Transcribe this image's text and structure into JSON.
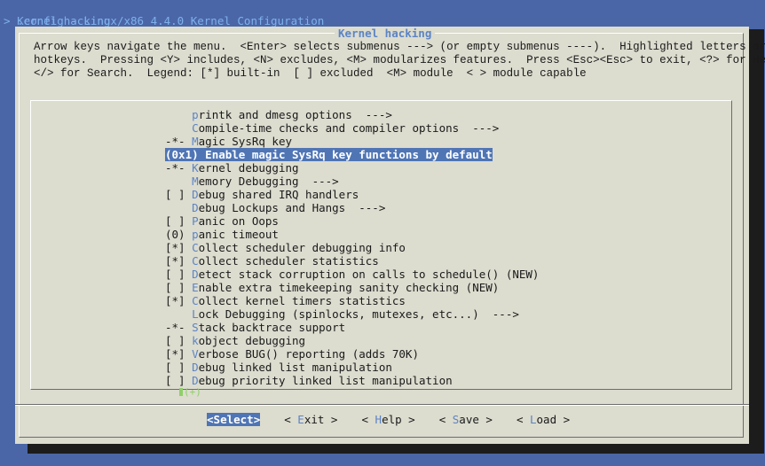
{
  "terminal": {
    "title": ".config - Linux/x86 4.4.0 Kernel Configuration",
    "breadcrumb_marker": ">",
    "breadcrumb": "Kernel hacking"
  },
  "dialog": {
    "title": "Kernel hacking",
    "instructions": [
      "Arrow keys navigate the menu.  <Enter> selects submenus ---> (or empty submenus ----).  Highlighted letters are",
      "hotkeys.  Pressing <Y> includes, <N> excludes, <M> modularizes features.  Press <Esc><Esc> to exit, <?> for Help,",
      "</> for Search.  Legend: [*] built-in  [ ] excluded  <M> module  < > module capable"
    ]
  },
  "menu": {
    "selected_index": 3,
    "items": [
      {
        "prefix": "    ",
        "hot": "p",
        "rest": "rintk and dmesg options  --->"
      },
      {
        "prefix": "    ",
        "hot": "C",
        "rest": "ompile-time checks and compiler options  --->"
      },
      {
        "prefix": "-*- ",
        "hot": "M",
        "rest": "agic SysRq key"
      },
      {
        "prefix": "(0x1) ",
        "hot": "E",
        "rest": "nable magic SysRq key functions by default"
      },
      {
        "prefix": "-*- ",
        "hot": "K",
        "rest": "ernel debugging"
      },
      {
        "prefix": "    ",
        "hot": "M",
        "rest": "emory Debugging  --->"
      },
      {
        "prefix": "[ ] ",
        "hot": "D",
        "rest": "ebug shared IRQ handlers"
      },
      {
        "prefix": "    ",
        "hot": "D",
        "rest": "ebug Lockups and Hangs  --->"
      },
      {
        "prefix": "[ ] ",
        "hot": "P",
        "rest": "anic on Oops"
      },
      {
        "prefix": "(0) ",
        "hot": "p",
        "rest": "anic timeout"
      },
      {
        "prefix": "[*] ",
        "hot": "C",
        "rest": "ollect scheduler debugging info"
      },
      {
        "prefix": "[*] ",
        "hot": "C",
        "rest": "ollect scheduler statistics"
      },
      {
        "prefix": "[ ] ",
        "hot": "D",
        "rest": "etect stack corruption on calls to schedule() (NEW)"
      },
      {
        "prefix": "[ ] ",
        "hot": "E",
        "rest": "nable extra timekeeping sanity checking (NEW)"
      },
      {
        "prefix": "[*] ",
        "hot": "C",
        "rest": "ollect kernel timers statistics"
      },
      {
        "prefix": "    ",
        "hot": "L",
        "rest": "ock Debugging (spinlocks, mutexes, etc...)  --->"
      },
      {
        "prefix": "-*- ",
        "hot": "S",
        "rest": "tack backtrace support"
      },
      {
        "prefix": "[ ] ",
        "hot": "k",
        "rest": "object debugging"
      },
      {
        "prefix": "[*] ",
        "hot": "V",
        "rest": "erbose BUG() reporting (adds 70K)"
      },
      {
        "prefix": "[ ] ",
        "hot": "D",
        "rest": "ebug linked list manipulation"
      },
      {
        "prefix": "[ ] ",
        "hot": "D",
        "rest": "ebug priority linked list manipulation"
      }
    ],
    "more_indicator": "(+)"
  },
  "buttons": [
    {
      "open": "<",
      "hot": "S",
      "label": "elect",
      "close": ">",
      "selected": true
    },
    {
      "open": "< ",
      "hot": "E",
      "label": "xit",
      "close": " >",
      "selected": false
    },
    {
      "open": "< ",
      "hot": "H",
      "label": "elp",
      "close": " >",
      "selected": false
    },
    {
      "open": "< ",
      "hot": "S",
      "label": "ave",
      "close": " >",
      "selected": false
    },
    {
      "open": "< ",
      "hot": "L",
      "label": "oad",
      "close": " >",
      "selected": false
    }
  ],
  "colors": {
    "background": "#4a66a6",
    "dialog": "#dcdccf",
    "highlight": "#4f75b5",
    "hotkey": "#5c84c4",
    "more_indicator": "#8fcf6a"
  }
}
